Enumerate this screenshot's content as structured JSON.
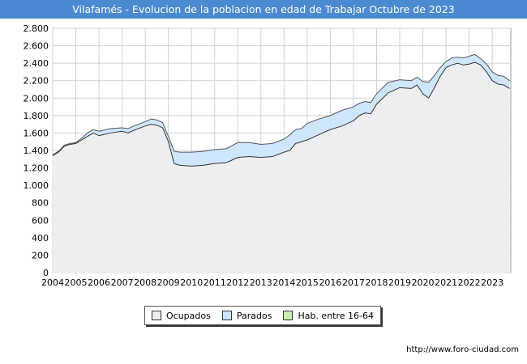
{
  "header": {
    "title": "Vilafamés - Evolucion de la poblacion en edad de Trabajar Octubre de 2023"
  },
  "footer": {
    "url": "http://www.foro-ciudad.com"
  },
  "legend": {
    "items": [
      {
        "label": "Ocupados",
        "color": "#eeeeee"
      },
      {
        "label": "Parados",
        "color": "#cce5ff"
      },
      {
        "label": "Hab. entre 16-64",
        "color": "#c8f0b0"
      }
    ]
  },
  "chart_data": {
    "type": "area",
    "title": "Vilafamés - Evolucion de la poblacion en edad de Trabajar Octubre de 2023",
    "ylim": [
      0,
      2800
    ],
    "xlim": [
      2004,
      2023.8
    ],
    "grid": true,
    "legend_position": "bottom",
    "y_ticks": [
      "0",
      "200",
      "400",
      "600",
      "800",
      "1.000",
      "1.200",
      "1.400",
      "1.600",
      "1.800",
      "2.000",
      "2.200",
      "2.400",
      "2.600",
      "2.800"
    ],
    "y_tick_values": [
      0,
      200,
      400,
      600,
      800,
      1000,
      1200,
      1400,
      1600,
      1800,
      2000,
      2200,
      2400,
      2600,
      2800
    ],
    "x_ticks": [
      "2004",
      "2005",
      "2006",
      "2007",
      "2008",
      "2009",
      "2010",
      "2011",
      "2012",
      "2013",
      "2014",
      "2015",
      "2016",
      "2017",
      "2018",
      "2019",
      "2020",
      "2021",
      "2022",
      "2023"
    ],
    "x_tick_values": [
      2004,
      2005,
      2006,
      2007,
      2008,
      2009,
      2010,
      2011,
      2012,
      2013,
      2014,
      2015,
      2016,
      2017,
      2018,
      2019,
      2020,
      2021,
      2022,
      2023
    ],
    "series": [
      {
        "name": "Ocupados",
        "color": "#eeeeee",
        "line_color": "#333333",
        "x": [
          2004,
          2004.25,
          2004.5,
          2004.75,
          2005,
          2005.25,
          2005.5,
          2005.75,
          2006,
          2006.5,
          2007,
          2007.25,
          2007.5,
          2008,
          2008.25,
          2008.5,
          2008.75,
          2009,
          2009.25,
          2009.5,
          2010,
          2010.5,
          2011,
          2011.5,
          2012,
          2012.5,
          2013,
          2013.5,
          2014,
          2014.25,
          2014.5,
          2014.75,
          2015,
          2015.5,
          2016,
          2016.5,
          2017,
          2017.25,
          2017.5,
          2017.75,
          2018,
          2018.5,
          2019,
          2019.5,
          2019.75,
          2020,
          2020.25,
          2020.5,
          2020.75,
          2021,
          2021.25,
          2021.5,
          2021.75,
          2022,
          2022.25,
          2022.5,
          2022.75,
          2023,
          2023.25,
          2023.5,
          2023.75
        ],
        "values": [
          1340,
          1380,
          1450,
          1470,
          1480,
          1520,
          1560,
          1600,
          1570,
          1600,
          1620,
          1600,
          1630,
          1680,
          1700,
          1690,
          1660,
          1500,
          1250,
          1230,
          1220,
          1230,
          1250,
          1260,
          1320,
          1330,
          1320,
          1330,
          1380,
          1400,
          1480,
          1500,
          1520,
          1580,
          1640,
          1680,
          1740,
          1800,
          1830,
          1820,
          1930,
          2060,
          2120,
          2110,
          2150,
          2050,
          2000,
          2120,
          2250,
          2350,
          2380,
          2400,
          2380,
          2390,
          2410,
          2380,
          2300,
          2200,
          2160,
          2150,
          2110
        ]
      },
      {
        "name": "Parados",
        "color": "#cce5ff",
        "line_color": "#555555",
        "x": [
          2004,
          2004.25,
          2004.5,
          2004.75,
          2005,
          2005.25,
          2005.5,
          2005.75,
          2006,
          2006.5,
          2007,
          2007.25,
          2007.5,
          2008,
          2008.25,
          2008.5,
          2008.75,
          2009,
          2009.25,
          2009.5,
          2010,
          2010.5,
          2011,
          2011.5,
          2012,
          2012.5,
          2013,
          2013.5,
          2014,
          2014.25,
          2014.5,
          2014.75,
          2015,
          2015.5,
          2016,
          2016.5,
          2017,
          2017.25,
          2017.5,
          2017.75,
          2018,
          2018.5,
          2019,
          2019.5,
          2019.75,
          2020,
          2020.25,
          2020.5,
          2020.75,
          2021,
          2021.25,
          2021.5,
          2021.75,
          2022,
          2022.25,
          2022.5,
          2022.75,
          2023,
          2023.25,
          2023.5,
          2023.75
        ],
        "values": [
          1350,
          1390,
          1460,
          1480,
          1490,
          1540,
          1600,
          1640,
          1620,
          1650,
          1660,
          1650,
          1680,
          1730,
          1760,
          1750,
          1720,
          1560,
          1390,
          1380,
          1380,
          1390,
          1410,
          1420,
          1490,
          1490,
          1470,
          1480,
          1530,
          1580,
          1640,
          1650,
          1710,
          1760,
          1800,
          1860,
          1900,
          1940,
          1960,
          1950,
          2050,
          2180,
          2210,
          2200,
          2240,
          2190,
          2180,
          2260,
          2350,
          2420,
          2460,
          2470,
          2460,
          2480,
          2500,
          2450,
          2390,
          2300,
          2260,
          2250,
          2200
        ]
      }
    ]
  }
}
